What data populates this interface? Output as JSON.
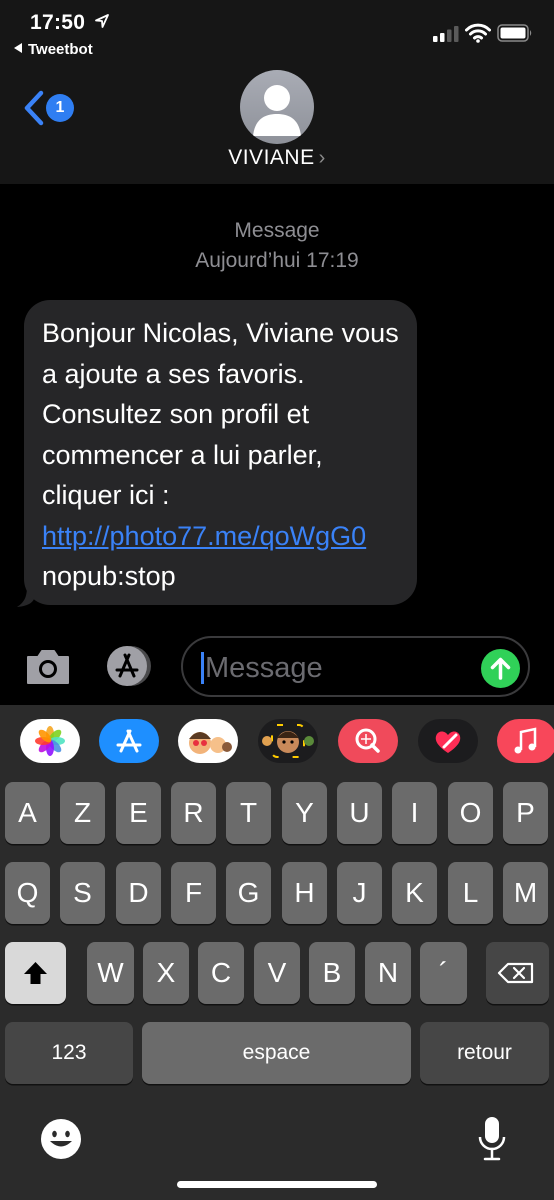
{
  "status_bar": {
    "time": "17:50",
    "back_app": "Tweetbot"
  },
  "nav": {
    "back_badge": "1",
    "contact_name": "VIVIANE",
    "contact_chevron": "›"
  },
  "conversation": {
    "service_label": "Message",
    "date_label": "Aujourd’hui 17:19",
    "message": {
      "text_before_link": "Bonjour Nicolas, Viviane vous a ajoute a ses favoris. Consultez son profil et commencer a lui parler, cliquer ici : ",
      "link": "http://photo77.me/qoWgG0",
      "text_after_link": "nopub:stop"
    }
  },
  "compose": {
    "placeholder": "Message"
  },
  "app_strip": [
    {
      "icon": "photos-icon",
      "color": "#ffffff"
    },
    {
      "icon": "app-store-icon",
      "color": "#1e8fff"
    },
    {
      "icon": "memoji-stickers-icon",
      "color": "#ffffff"
    },
    {
      "icon": "animoji-icon",
      "color": "#1c1c1e"
    },
    {
      "icon": "images-search-icon",
      "color": "#f04a5b"
    },
    {
      "icon": "digital-touch-icon",
      "color": "#1c1c1e"
    },
    {
      "icon": "music-icon",
      "color": "#f8475a"
    }
  ],
  "keyboard": {
    "row1": [
      "A",
      "Z",
      "E",
      "R",
      "T",
      "Y",
      "U",
      "I",
      "O",
      "P"
    ],
    "row2": [
      "Q",
      "S",
      "D",
      "F",
      "G",
      "H",
      "J",
      "K",
      "L",
      "M"
    ],
    "row3": [
      "W",
      "X",
      "C",
      "V",
      "B",
      "N",
      "´"
    ],
    "numbers_label": "123",
    "space_label": "espace",
    "return_label": "retour"
  },
  "colors": {
    "accent_blue": "#3a82f7",
    "send_green": "#30d158",
    "bubble_gray": "#262628"
  }
}
